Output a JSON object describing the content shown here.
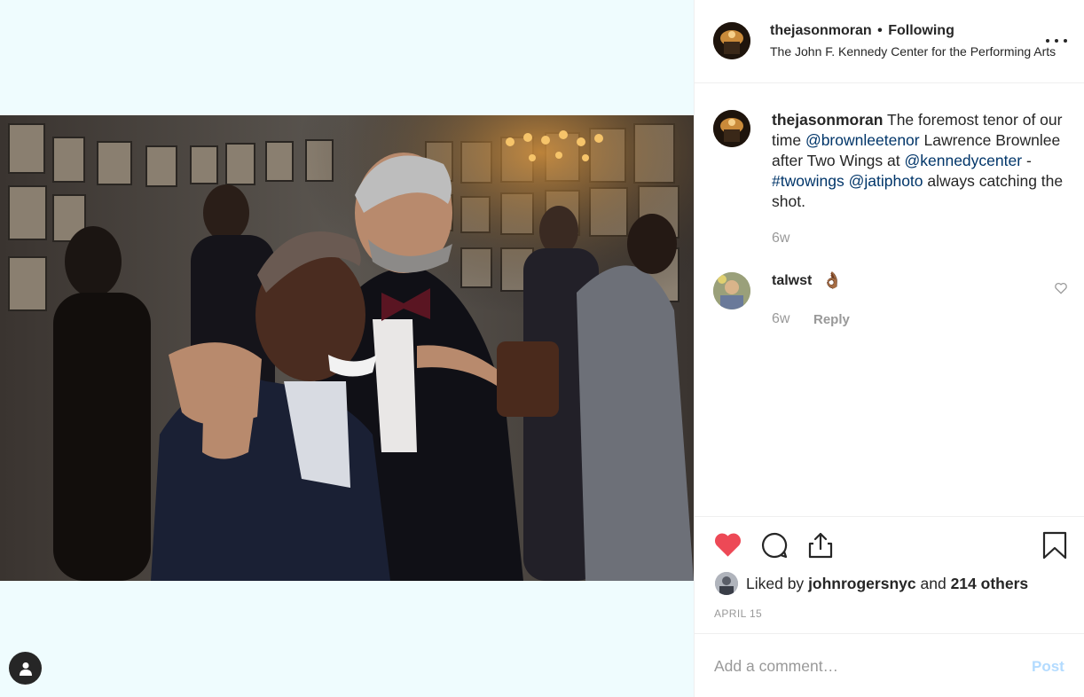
{
  "post": {
    "username": "thejasonmoran",
    "follow_status": "Following",
    "separator": "•",
    "location": "The John F. Kennedy Center for the Performing Arts"
  },
  "caption": {
    "username": "thejasonmoran",
    "text_1": "The foremost tenor of our time",
    "mention_1": "@brownleetenor",
    "text_2": "Lawrence Brownlee after Two Wings at",
    "mention_2": "@kennedycenter",
    "text_3": "-",
    "hashtag_1": "#twowings",
    "mention_3": "@jatiphoto",
    "text_4": "always catching the shot.",
    "time": "6w"
  },
  "comments": [
    {
      "username": "talwst",
      "text": "👌🏾",
      "time": "6w",
      "reply_label": "Reply"
    }
  ],
  "likes": {
    "prefix": "Liked by",
    "first_liker": "johnrogersnyc",
    "conjunction": "and",
    "others": "214 others"
  },
  "date": "APRIL 15",
  "comment_box": {
    "placeholder": "Add a comment…",
    "post_label": "Post"
  },
  "colors": {
    "liked_heart": "#ed4956",
    "link": "#003569",
    "post_disabled": "#b3dbff"
  },
  "icons": [
    "person-icon",
    "more-options-icon",
    "heart-filled-icon",
    "comment-icon",
    "share-icon",
    "bookmark-icon",
    "heart-outline-icon"
  ]
}
